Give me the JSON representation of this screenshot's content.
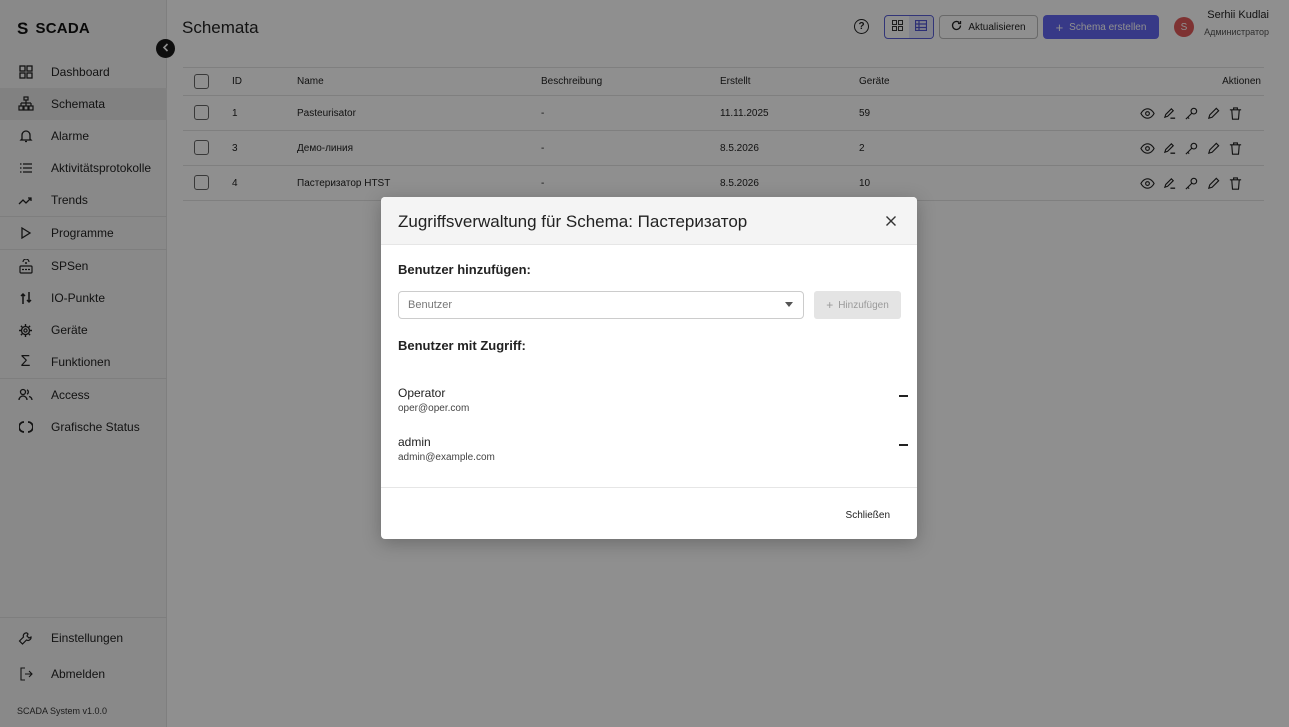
{
  "brand": {
    "letter": "S",
    "name": "SCADA"
  },
  "sidebar": {
    "items": [
      {
        "label": "Dashboard",
        "icon": "dashboard-icon"
      },
      {
        "label": "Schemata",
        "icon": "hierarchy-icon",
        "active": true
      },
      {
        "label": "Alarme",
        "icon": "bell-icon"
      },
      {
        "label": "Aktivitätsprotokolle",
        "icon": "list-icon"
      },
      {
        "label": "Trends",
        "icon": "trend-icon"
      },
      {
        "label": "Programme",
        "icon": "play-icon"
      },
      {
        "label": "SPSen",
        "icon": "plc-icon"
      },
      {
        "label": "IO-Punkte",
        "icon": "io-icon"
      },
      {
        "label": "Geräte",
        "icon": "gear-icon"
      },
      {
        "label": "Funktionen",
        "icon": "sigma-icon"
      },
      {
        "label": "Access",
        "icon": "users-icon"
      },
      {
        "label": "Grafische Status",
        "icon": "status-icon"
      }
    ],
    "bottom": [
      {
        "label": "Einstellungen",
        "icon": "wrench-icon"
      },
      {
        "label": "Abmelden",
        "icon": "logout-icon"
      }
    ],
    "version": "SCADA System v1.0.0"
  },
  "header": {
    "title": "Schemata",
    "refresh_label": "Aktualisieren",
    "create_label": "Schema erstellen",
    "user_initial": "S",
    "user_name": "Serhii Kudlai",
    "user_role": "Администратор"
  },
  "table": {
    "columns": {
      "id": "ID",
      "name": "Name",
      "desc": "Beschreibung",
      "created": "Erstellt",
      "devices": "Geräte",
      "actions": "Aktionen"
    },
    "rows": [
      {
        "id": "1",
        "name": "Pasteurisator",
        "desc": "-",
        "created": "11.11.2025",
        "devices": "59"
      },
      {
        "id": "3",
        "name": "Демо-линия",
        "desc": "-",
        "created": "8.5.2026",
        "devices": "2"
      },
      {
        "id": "4",
        "name": "Пастеризатор HTST",
        "desc": "-",
        "created": "8.5.2026",
        "devices": "10"
      }
    ]
  },
  "modal": {
    "title": "Zugriffsverwaltung für Schema: Пастеризатор",
    "add_section": "Benutzer hinzufügen:",
    "select_placeholder": "Benutzer",
    "add_button": "Hinzufügen",
    "access_section": "Benutzer mit Zugriff:",
    "users": [
      {
        "name": "Operator",
        "email": "oper@oper.com"
      },
      {
        "name": "admin",
        "email": "admin@example.com"
      }
    ],
    "close_button": "Schließen"
  }
}
